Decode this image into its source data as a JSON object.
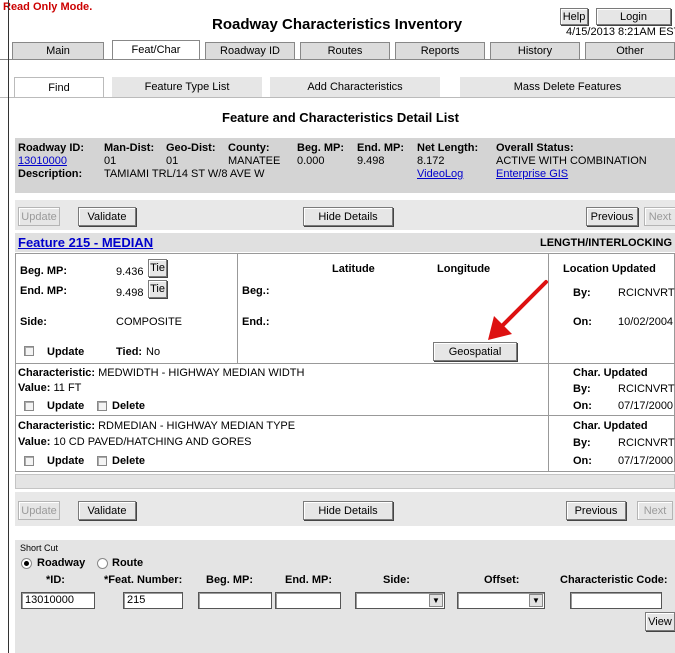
{
  "header": {
    "mode": "Read Only Mode",
    "mode_dot": ".",
    "title": "Roadway Characteristics Inventory",
    "help": "Help",
    "login": "Login",
    "datetime": "4/15/2013  8:21AM EST"
  },
  "tabs": [
    "Main",
    "Feat/Char",
    "Roadway ID",
    "Routes",
    "Reports",
    "History",
    "Other"
  ],
  "subtabs": [
    "Find",
    "Feature Type List",
    "Add Characteristics",
    "Mass Delete Features"
  ],
  "page_title": "Feature and Characteristics Detail List",
  "roadway": {
    "headers": [
      "Roadway ID:",
      "Man-Dist:",
      "Geo-Dist:",
      "County:",
      "Beg. MP:",
      "End. MP:",
      "Net Length:",
      "Overall Status:"
    ],
    "values": [
      "13010000",
      "01",
      "01",
      "MANATEE",
      "0.000",
      "9.498",
      "8.172",
      "ACTIVE WITH COMBINATION"
    ],
    "description_label": "Description:",
    "description": "TAMIAMI TRL/14 ST W/8 AVE W",
    "videolog": "VideoLog",
    "gis": "Enterprise GIS"
  },
  "toolbar": {
    "update": "Update",
    "validate": "Validate",
    "hide_details": "Hide Details",
    "previous": "Previous",
    "next": "Next"
  },
  "feature": {
    "title": "Feature 215 - MEDIAN",
    "type": "LENGTH/INTERLOCKING",
    "beg_mp_label": "Beg. MP:",
    "beg_mp": "9.436",
    "end_mp_label": "End. MP:",
    "end_mp": "9.498",
    "tie": "Tie",
    "side_label": "Side:",
    "side": "COMPOSITE",
    "update_label": "Update",
    "tied_label": "Tied:",
    "tied": "No",
    "lat_header": "Latitude",
    "lon_header": "Longitude",
    "beg_label": "Beg.:",
    "end_label": "End.:",
    "geospatial": "Geospatial",
    "loc_updated": "Location Updated",
    "by_label": "By:",
    "by": "RCICNVRT",
    "on_label": "On:",
    "on": "10/02/2004"
  },
  "characteristics": [
    {
      "char_label": "Characteristic:",
      "char": "MEDWIDTH - HIGHWAY MEDIAN WIDTH",
      "value_label": "Value:",
      "value": "11  FT",
      "update": "Update",
      "delete": "Delete",
      "updated": "Char. Updated",
      "by_label": "By:",
      "by": "RCICNVRT",
      "on_label": "On:",
      "on": "07/17/2000"
    },
    {
      "char_label": "Characteristic:",
      "char": "RDMEDIAN - HIGHWAY MEDIAN TYPE",
      "value_label": "Value:",
      "value": "10  CD  PAVED/HATCHING AND GORES",
      "update": "Update",
      "delete": "Delete",
      "updated": "Char. Updated",
      "by_label": "By:",
      "by": "RCICNVRT",
      "on_label": "On:",
      "on": "07/17/2000"
    }
  ],
  "shortcut": {
    "title": "Short Cut",
    "roadway": "Roadway",
    "route": "Route",
    "id_label": "*ID:",
    "feat_label": "*Feat. Number:",
    "beg_label": "Beg. MP:",
    "end_label": "End. MP:",
    "side_label": "Side:",
    "offset_label": "Offset:",
    "char_code_label": "Characteristic Code:",
    "id_value": "13010000",
    "feat_value": "215",
    "view": "View"
  },
  "colors": {
    "accent_red": "#cc0000",
    "link_blue": "#0000cc",
    "gray_bar": "#d4d4d4",
    "panel": "#e8e8e8"
  }
}
